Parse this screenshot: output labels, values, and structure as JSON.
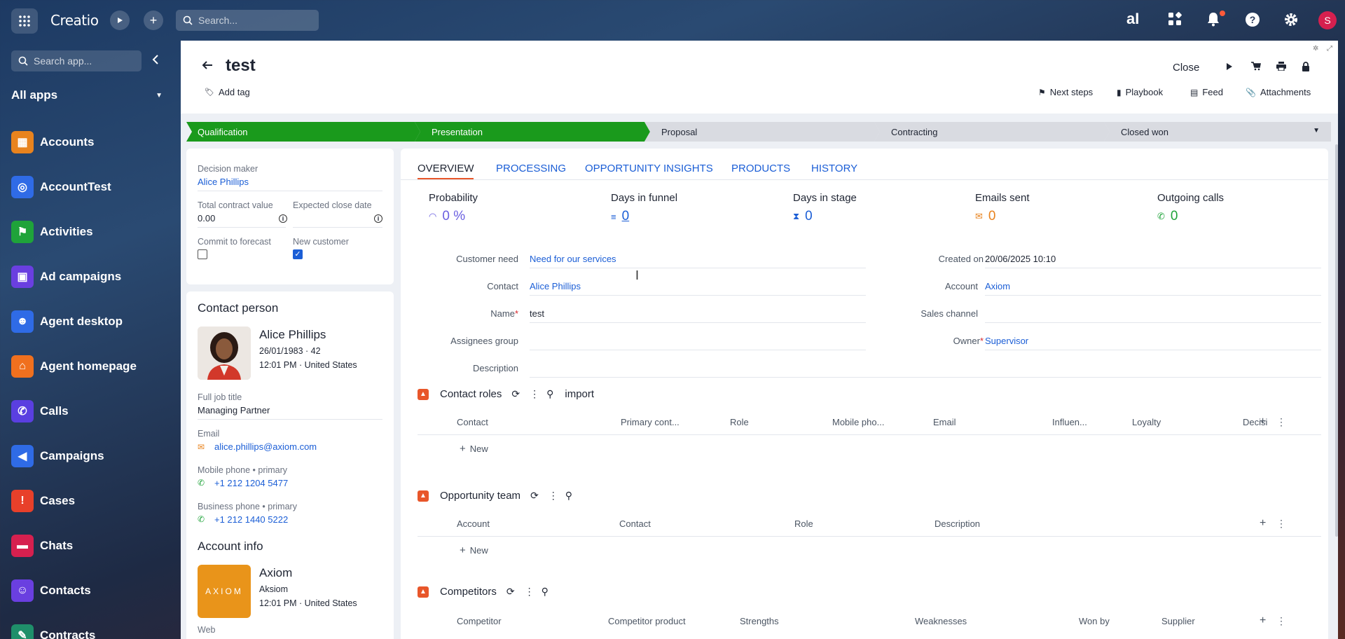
{
  "topbar": {
    "logo": "Creatio",
    "search_placeholder": "Search...",
    "ai_label": "aI",
    "avatar_initial": "S"
  },
  "sidebar": {
    "search_placeholder": "Search app...",
    "section_title": "All apps",
    "items": [
      {
        "label": "Accounts",
        "icon": "accounts-icon",
        "color": "#e8831e"
      },
      {
        "label": "AccountTest",
        "icon": "account-test-icon",
        "color": "#2f6be6"
      },
      {
        "label": "Activities",
        "icon": "flag-icon",
        "color": "#1fa33a"
      },
      {
        "label": "Ad campaigns",
        "icon": "ad-campaigns-icon",
        "color": "#6a3fe0"
      },
      {
        "label": "Agent desktop",
        "icon": "agent-desktop-icon",
        "color": "#2f6be6"
      },
      {
        "label": "Agent homepage",
        "icon": "home-icon",
        "color": "#f0701e"
      },
      {
        "label": "Calls",
        "icon": "phone-icon",
        "color": "#5a3fe0"
      },
      {
        "label": "Campaigns",
        "icon": "megaphone-icon",
        "color": "#2f6be6"
      },
      {
        "label": "Cases",
        "icon": "cases-icon",
        "color": "#e8402a"
      },
      {
        "label": "Chats",
        "icon": "chat-icon",
        "color": "#d6204f"
      },
      {
        "label": "Contacts",
        "icon": "contacts-icon",
        "color": "#6a3fe0"
      },
      {
        "label": "Contracts",
        "icon": "contracts-icon",
        "color": "#1f8f6a"
      }
    ]
  },
  "header": {
    "title": "test",
    "add_tag": "Add tag",
    "close": "Close",
    "links": [
      "Next steps",
      "Playbook",
      "Feed",
      "Attachments"
    ]
  },
  "stages": [
    {
      "label": "Qualification",
      "state": "done"
    },
    {
      "label": "Presentation",
      "state": "done"
    },
    {
      "label": "Proposal",
      "state": "todo"
    },
    {
      "label": "Contracting",
      "state": "todo"
    },
    {
      "label": "Closed won",
      "state": "todo"
    }
  ],
  "summary": {
    "decision_maker_label": "Decision maker",
    "decision_maker": "Alice Phillips",
    "total_contract_label": "Total contract value",
    "total_contract": "0.00",
    "expected_close_label": "Expected close date",
    "commit_label": "Commit to forecast",
    "commit_checked": false,
    "new_customer_label": "New customer",
    "new_customer_checked": true
  },
  "contact": {
    "section_title": "Contact person",
    "name": "Alice Phillips",
    "dob": "26/01/1983 · 42",
    "time_location": "12:01 PM · United States",
    "job_title_label": "Full job title",
    "job_title": "Managing Partner",
    "email_label": "Email",
    "email": "alice.phillips@axiom.com",
    "mobile_label": "Mobile phone • primary",
    "mobile": "+1 212 1204 5477",
    "business_label": "Business phone • primary",
    "business": "+1 212 1440 5222"
  },
  "account": {
    "section_title": "Account info",
    "logo_text": "AXIOM",
    "name": "Axiom",
    "alt_name": "Aksiom",
    "time_location": "12:01 PM · United States",
    "web_label": "Web"
  },
  "tabs": [
    "OVERVIEW",
    "PROCESSING",
    "OPPORTUNITY INSIGHTS",
    "PRODUCTS",
    "HISTORY"
  ],
  "metrics": [
    {
      "label": "Probability",
      "value": "0 %",
      "icon": "gauge-icon",
      "color": "#6a5fe0"
    },
    {
      "label": "Days in funnel",
      "value": "0",
      "icon": "funnel-icon",
      "color": "#1b5ed6"
    },
    {
      "label": "Days in stage",
      "value": "0",
      "icon": "hourglass-icon",
      "color": "#1b5ed6"
    },
    {
      "label": "Emails sent",
      "value": "0",
      "icon": "email-icon",
      "color": "#e8831e"
    },
    {
      "label": "Outgoing calls",
      "value": "0",
      "icon": "phone-icon",
      "color": "#1fa33a"
    }
  ],
  "fields": {
    "customer_need_label": "Customer need",
    "customer_need": "Need for our services",
    "contact_label": "Contact",
    "contact": "Alice Phillips",
    "name_label": "Name",
    "name": "test",
    "assignees_label": "Assignees group",
    "description_label": "Description",
    "created_on_label": "Created on",
    "created_on": "20/06/2025 10:10",
    "account_label": "Account",
    "account": "Axiom",
    "sales_channel_label": "Sales channel",
    "owner_label": "Owner",
    "owner": "Supervisor"
  },
  "contact_roles": {
    "title": "Contact roles",
    "extra": "import",
    "columns": [
      "Contact",
      "Primary cont...",
      "Role",
      "Mobile pho...",
      "Email",
      "Influen...",
      "Loyalty",
      "Decisi"
    ],
    "new_label": "New"
  },
  "opportunity_team": {
    "title": "Opportunity team",
    "columns": [
      "Account",
      "Contact",
      "Role",
      "Description"
    ],
    "new_label": "New"
  },
  "competitors": {
    "title": "Competitors",
    "columns": [
      "Competitor",
      "Competitor product",
      "Strengths",
      "Weaknesses",
      "Won by",
      "Supplier"
    ]
  }
}
